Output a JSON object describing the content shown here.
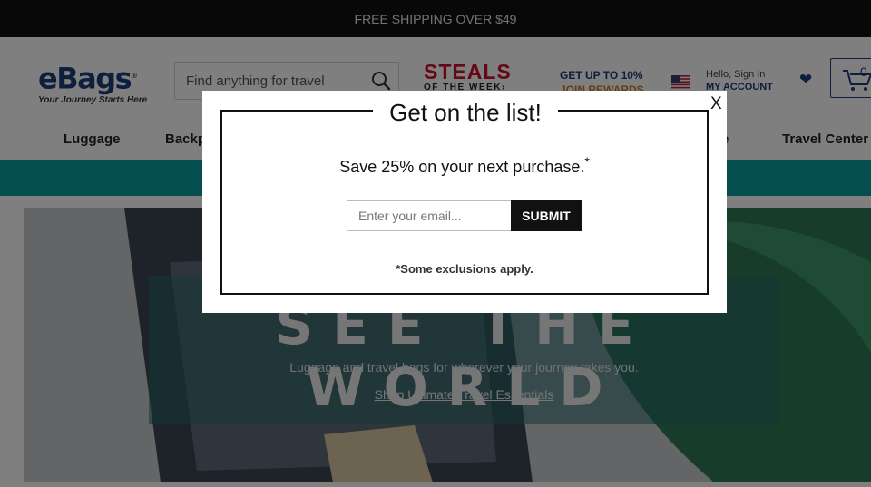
{
  "topbar": {
    "message": "FREE SHIPPING OVER $49"
  },
  "header": {
    "logo_text": "eBags",
    "logo_reg": "®",
    "logo_tagline": "Your Journey Starts Here",
    "search_placeholder": "Find anything for travel",
    "steals_line1": "STEALS",
    "steals_line2": "OF THE WEEK›",
    "rewards_line1": "GET UP TO 10%",
    "rewards_line2": "JOIN REWARDS",
    "account_greeting": "Hello, Sign In",
    "account_label": "MY ACCOUNT",
    "wishlist_icon": "heart-icon",
    "cart_count": "0"
  },
  "nav": {
    "items": [
      "Luggage",
      "Backp",
      "e",
      "Travel Center"
    ]
  },
  "hero": {
    "title": "SEE THE WORLD",
    "subtitle": "Luggage and travel bags for wherever your journey takes you.",
    "link": "Shop Ultimate Travel Essentials"
  },
  "modal": {
    "title": "Get on the list!",
    "close_label": "X",
    "offer_text": "Save 25% on your next purchase.",
    "offer_mark": "*",
    "email_placeholder": "Enter your email...",
    "submit_label": "SUBMIT",
    "note": "*Some exclusions apply."
  },
  "colors": {
    "brand_navy": "#1d3c7a",
    "accent_red": "#c8102e",
    "promo_teal": "#0d9aa0",
    "rewards_orange": "#c77d2a"
  }
}
